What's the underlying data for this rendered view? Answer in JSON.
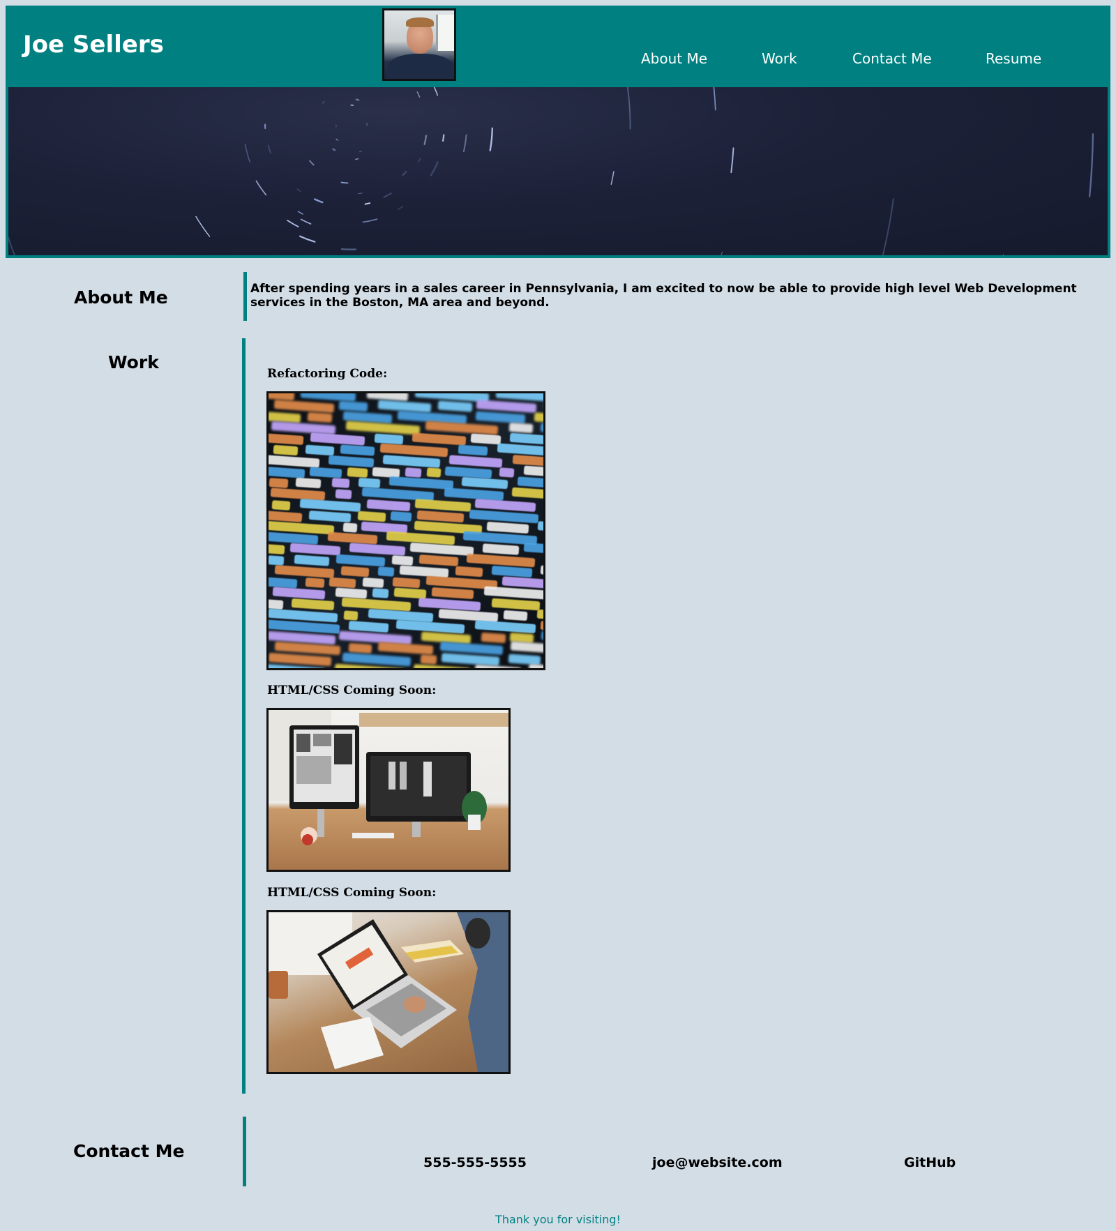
{
  "header": {
    "title": "Joe Sellers",
    "nav": [
      {
        "label": "About Me"
      },
      {
        "label": "Work"
      },
      {
        "label": "Contact Me"
      },
      {
        "label": "Resume"
      }
    ]
  },
  "about": {
    "heading": "About Me",
    "text": "After spending years in a sales career in Pennsylvania, I am excited to now be able to provide high level Web Development services in the Boston, MA area and beyond."
  },
  "work": {
    "heading": "Work",
    "items": [
      {
        "label": "Refactoring Code:"
      },
      {
        "label": "HTML/CSS Coming Soon:"
      },
      {
        "label": "HTML/CSS Coming Soon:"
      }
    ]
  },
  "contact": {
    "heading": "Contact Me",
    "phone": "555-555-5555",
    "email": "joe@website.com",
    "github": "GitHub"
  },
  "footer": {
    "text": "Thank you for visiting!"
  },
  "colors": {
    "accent": "#008080",
    "background": "#d3dde6",
    "header_text": "#ffffff"
  }
}
